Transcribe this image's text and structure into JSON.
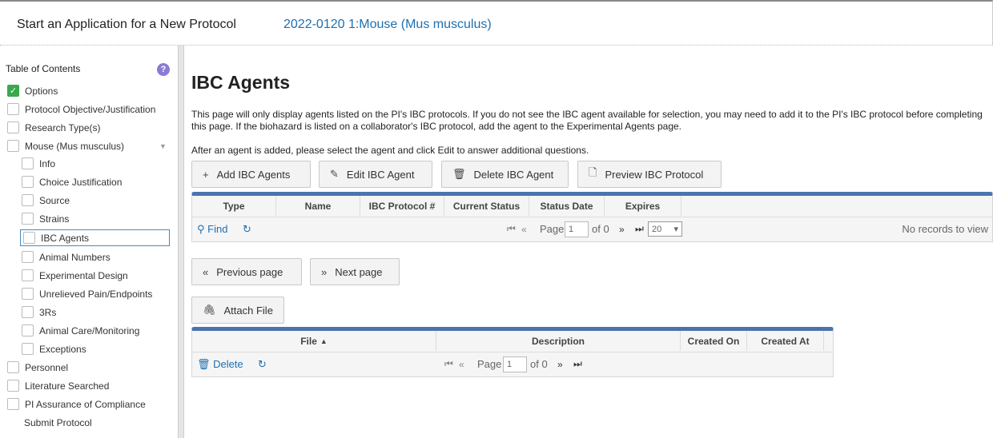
{
  "header": {
    "app_title": "Start an Application for a New Protocol",
    "protocol_link": "2022-0120 1:Mouse (Mus musculus)"
  },
  "sidebar": {
    "title": "Table of Contents",
    "help_icon": "?",
    "items": [
      {
        "label": "Options",
        "checked": true
      },
      {
        "label": "Protocol Objective/Justification"
      },
      {
        "label": "Research Type(s)"
      },
      {
        "label": "Mouse (Mus musculus)"
      },
      {
        "label": "Info"
      },
      {
        "label": "Choice Justification"
      },
      {
        "label": "Source"
      },
      {
        "label": "Strains"
      },
      {
        "label": "IBC Agents",
        "active": true
      },
      {
        "label": "Animal Numbers"
      },
      {
        "label": "Experimental Design"
      },
      {
        "label": "Unrelieved Pain/Endpoints"
      },
      {
        "label": "3Rs"
      },
      {
        "label": "Animal Care/Monitoring"
      },
      {
        "label": "Exceptions"
      },
      {
        "label": "Personnel"
      },
      {
        "label": "Literature Searched"
      },
      {
        "label": "PI Assurance of Compliance"
      },
      {
        "label": "Submit Protocol"
      }
    ]
  },
  "main": {
    "title": "IBC Agents",
    "note1": "This page will only display agents listed on the PI's IBC protocols. If you do not see the IBC agent available for selection, you may need to add it to the PI's IBC protocol before completing this page. If the biohazard is listed on a collaborator's IBC protocol, add the agent to the Experimental Agents page.",
    "note2": "After an agent is added, please select the agent and click Edit to answer additional questions.",
    "buttons": {
      "add": "Add IBC Agents",
      "edit": "Edit IBC Agent",
      "delete": "Delete IBC Agent",
      "preview": "Preview IBC Protocol",
      "prev": "Previous page",
      "next": "Next page",
      "attach": "Attach File"
    },
    "agents_grid": {
      "columns": [
        "Type",
        "Name",
        "IBC Protocol #",
        "Current Status",
        "Status Date",
        "Expires"
      ],
      "find": "Find",
      "page_label": "Page",
      "page_value": "1",
      "of_label": "of 0",
      "page_size": "20",
      "empty": "No records to view"
    },
    "files_grid": {
      "columns": [
        "File",
        "Description",
        "Created On",
        "Created At"
      ],
      "delete": "Delete",
      "page_label": "Page",
      "page_value": "1",
      "of_label": "of 0"
    }
  },
  "colors": {
    "link": "#1f6fb0",
    "grid_accent": "#4a74b0",
    "checked": "#3aa84c",
    "help": "#8a7bd6"
  }
}
